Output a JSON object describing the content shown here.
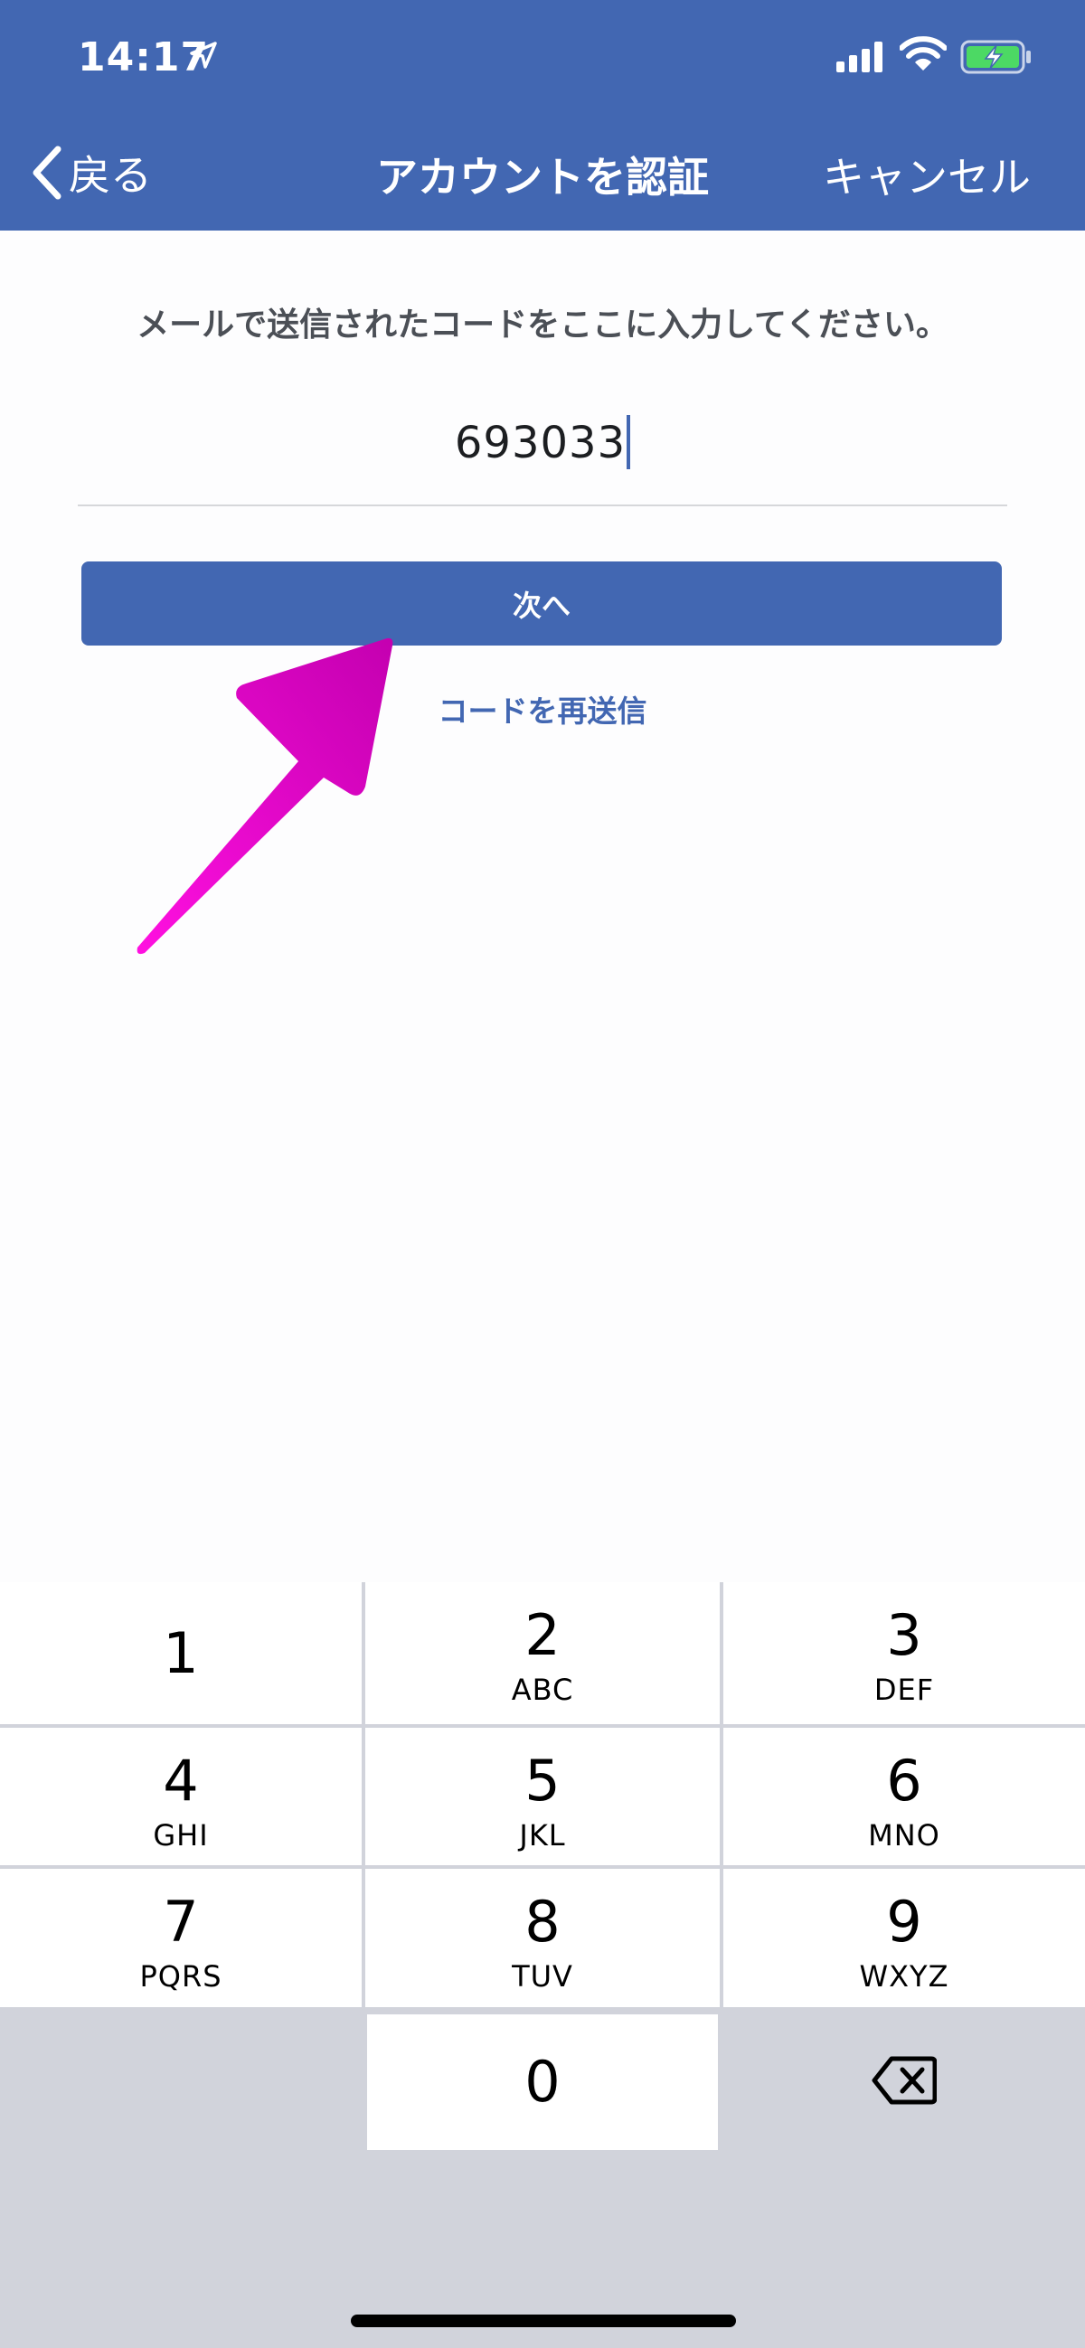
{
  "status_bar": {
    "time": "14:17",
    "icons": [
      "location-arrow-icon",
      "signal-bars-icon",
      "wifi-icon",
      "battery-charging-icon"
    ]
  },
  "nav": {
    "back_label": "戻る",
    "title": "アカウントを認証",
    "cancel_label": "キャンセル"
  },
  "verification": {
    "instruction": "メールで送信されたコードをここに入力してください。",
    "code_value": "693033",
    "next_label": "次へ",
    "resend_label": "コードを再送信"
  },
  "keypad": {
    "keys": [
      {
        "digit": "1",
        "letters": ""
      },
      {
        "digit": "2",
        "letters": "ABC"
      },
      {
        "digit": "3",
        "letters": "DEF"
      },
      {
        "digit": "4",
        "letters": "GHI"
      },
      {
        "digit": "5",
        "letters": "JKL"
      },
      {
        "digit": "6",
        "letters": "MNO"
      },
      {
        "digit": "7",
        "letters": "PQRS"
      },
      {
        "digit": "8",
        "letters": "TUV"
      },
      {
        "digit": "9",
        "letters": "WXYZ"
      },
      {
        "digit": "0",
        "letters": ""
      }
    ],
    "delete_icon": "backspace-icon"
  },
  "colors": {
    "brand": "#4267b2",
    "annotation_arrow": "#e600c8",
    "keypad_background": "#d1d3db"
  }
}
